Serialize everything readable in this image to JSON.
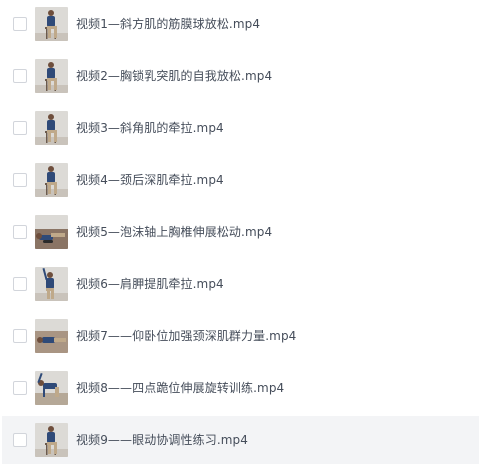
{
  "files": [
    {
      "name": "视频1—斜方肌的筋膜球放松.mp4",
      "checked": false,
      "thumbnail": "person-seated-wall-thumbnail",
      "scene": "wall"
    },
    {
      "name": "视频2—胸锁乳突肌的自我放松.mp4",
      "checked": false,
      "thumbnail": "person-seated-wall-thumbnail",
      "scene": "wall"
    },
    {
      "name": "视频3—斜角肌的牵拉.mp4",
      "checked": false,
      "thumbnail": "person-seated-stool-thumbnail",
      "scene": "stool"
    },
    {
      "name": "视频4—颈后深肌牵拉.mp4",
      "checked": false,
      "thumbnail": "person-seated-stool-thumbnail",
      "scene": "stool"
    },
    {
      "name": "视频5—泡沫轴上胸椎伸展松动.mp4",
      "checked": false,
      "thumbnail": "person-floor-foam-roller-thumbnail",
      "scene": "floor"
    },
    {
      "name": "视频6—肩胛提肌牵拉.mp4",
      "checked": false,
      "thumbnail": "person-standing-arm-raised-thumbnail",
      "scene": "arm"
    },
    {
      "name": "视频7——仰卧位加强颈深肌群力量.mp4",
      "checked": false,
      "thumbnail": "person-lying-supine-thumbnail",
      "scene": "lying"
    },
    {
      "name": "视频8——四点跪位伸展旋转训练.mp4",
      "checked": false,
      "thumbnail": "person-kneeling-thumbnail",
      "scene": "kneel"
    },
    {
      "name": "视频9——眼动协调性练习.mp4",
      "checked": false,
      "thumbnail": "person-seated-stool-thumbnail",
      "scene": "stool",
      "highlighted": true
    }
  ],
  "colors": {
    "text": "#454d5a",
    "checkbox_border": "#d2d5db",
    "row_highlight": "#f3f4f6",
    "shirt": "#2f4a78",
    "pants": "#bfa98a",
    "wall": "#dcdad6",
    "floor": "#8a7464"
  }
}
